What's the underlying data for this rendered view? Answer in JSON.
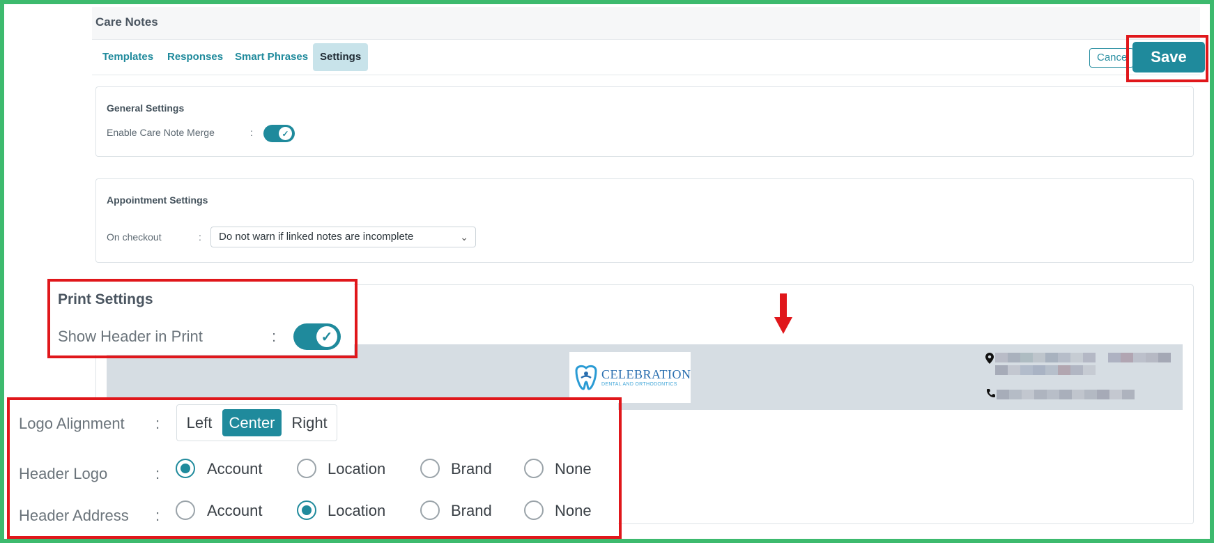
{
  "header": {
    "title": "Care Notes"
  },
  "tabs": [
    {
      "label": "Templates",
      "active": false
    },
    {
      "label": "Responses",
      "active": false
    },
    {
      "label": "Smart Phrases",
      "active": false
    },
    {
      "label": "Settings",
      "active": true
    }
  ],
  "actions": {
    "cancel_label": "Cancel",
    "save_label": "Save"
  },
  "general_settings": {
    "title": "General Settings",
    "enable_merge_label": "Enable Care Note Merge",
    "colon": ":",
    "enable_merge_on": true
  },
  "appointment_settings": {
    "title": "Appointment Settings",
    "on_checkout_label": "On checkout",
    "colon": ":",
    "on_checkout_value": "Do not warn if linked notes are incomplete"
  },
  "print_settings": {
    "title": "Print Settings",
    "show_header_label": "Show Header in Print",
    "colon": ":",
    "show_header_on": true,
    "preview_logo": {
      "main": "CELEBRATION",
      "sub": "DENTAL AND ORTHODONTICS"
    },
    "logo_alignment": {
      "label": "Logo Alignment",
      "options": [
        "Left",
        "Center",
        "Right"
      ],
      "selected": "Center"
    },
    "header_logo": {
      "label": "Header Logo",
      "options": [
        "Account",
        "Location",
        "Brand",
        "None"
      ],
      "selected": "Account"
    },
    "header_address": {
      "label": "Header Address",
      "options": [
        "Account",
        "Location",
        "Brand",
        "None"
      ],
      "selected": "Location"
    }
  },
  "colors": {
    "accent": "#1f8a9c",
    "highlight_box": "#e0171b",
    "frame": "#3dba6e"
  },
  "icons": {
    "arrow": "arrow-down-icon",
    "location": "map-pin-icon",
    "phone": "phone-icon",
    "chevron": "chevron-down-icon",
    "check": "check-icon"
  }
}
